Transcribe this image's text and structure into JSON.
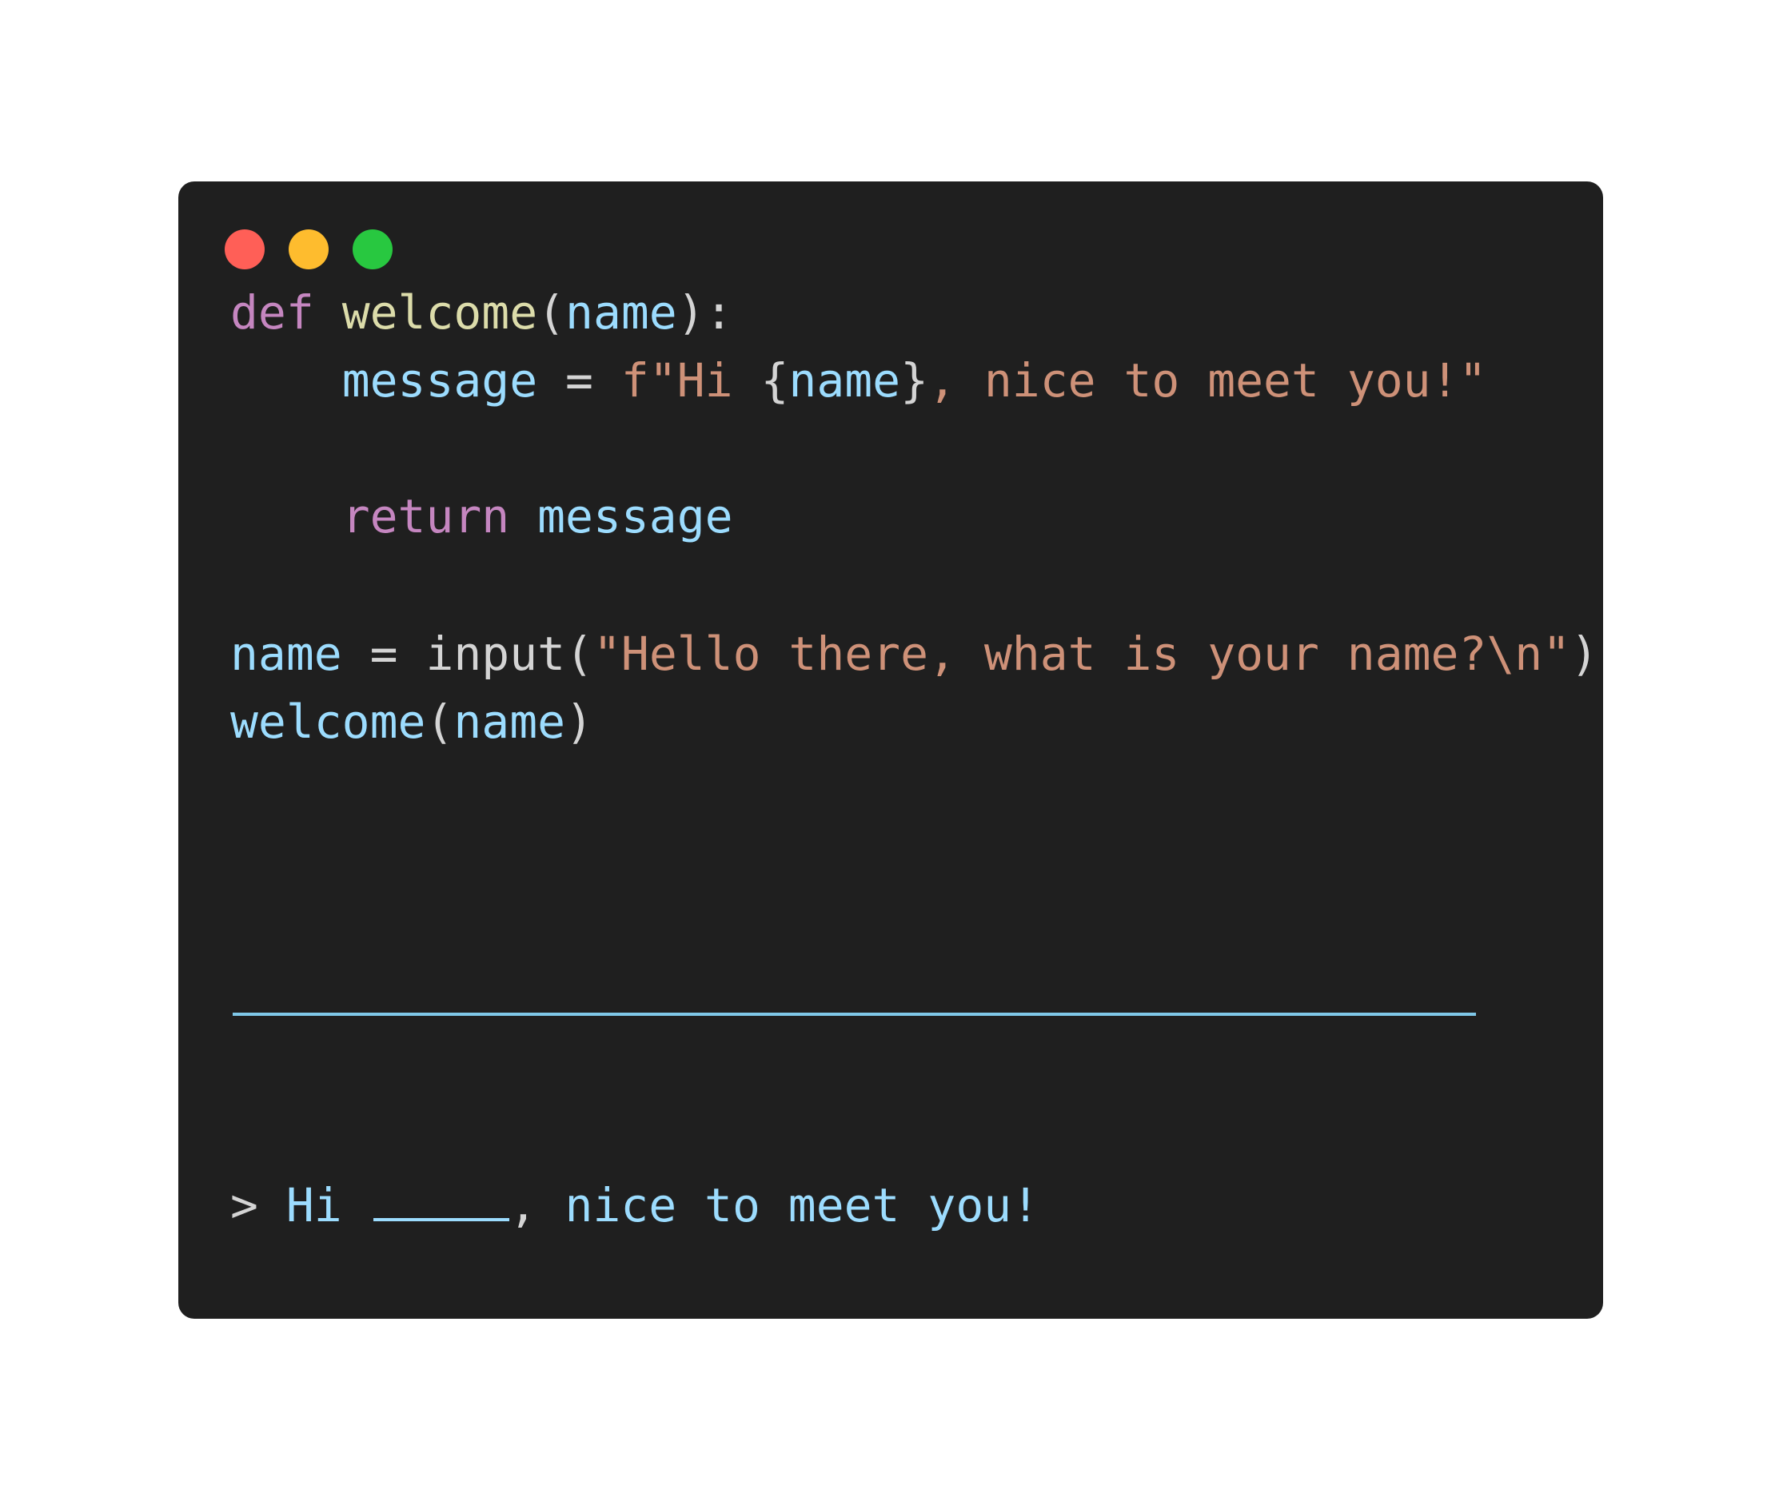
{
  "window": {
    "controls": {
      "close_color": "#ff5f57",
      "minimize_color": "#febc2e",
      "zoom_color": "#28c840"
    }
  },
  "code": {
    "line1": {
      "kw": "def",
      "fn": "welcome",
      "p1": "(",
      "arg": "name",
      "p2": "):"
    },
    "line2": {
      "var": "message",
      "op": " = ",
      "str1": "f\"Hi ",
      "b1": "{",
      "interp": "name",
      "b2": "}",
      "str2": ", nice to meet you!\""
    },
    "line3": {
      "kw": "return",
      "var": "message"
    },
    "line4": {
      "var": "name",
      "op": " = ",
      "fn": "input",
      "p1": "(",
      "str": "\"Hello there, what is your name?\\n\"",
      "p2": ")"
    },
    "line5": {
      "fn": "welcome",
      "p1": "(",
      "arg": "name",
      "p2": ")"
    }
  },
  "output": {
    "prompt": "> ",
    "text_before": "Hi ",
    "comma": ",",
    "text_after": " nice to meet you!"
  }
}
